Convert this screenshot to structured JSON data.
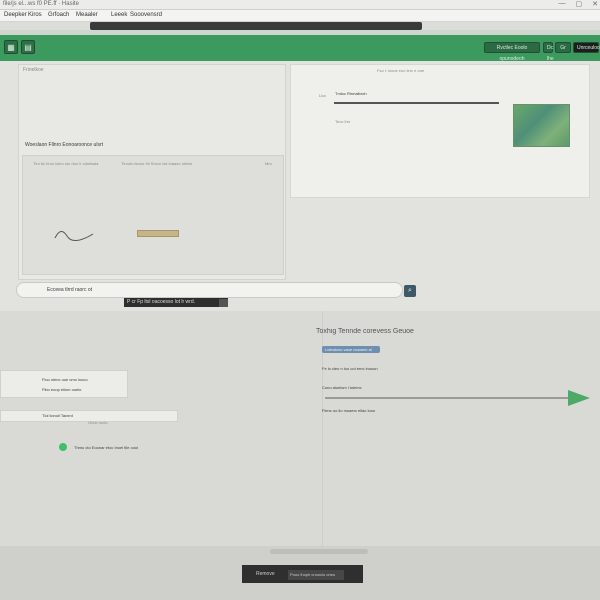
{
  "window": {
    "title": "file/js el...ws f0 PE.ff · Hasite",
    "controls": [
      "—",
      "▢",
      "✕"
    ]
  },
  "menubar": {
    "items": [
      "Deepker",
      "Kiros",
      "Grfoach",
      "Meaaler",
      "Leeek",
      "Sooovensrd"
    ]
  },
  "toolbar": {
    "left_icons": [
      "grid-icon",
      "layers-icon"
    ],
    "right_buttons": [
      "Rvctlec Eoolo opunodeoh",
      "Dc lhe",
      "Gr",
      "Unrceuloolse"
    ]
  },
  "left_pane": {
    "header_line": "Frinelkoe",
    "section_title": "Woeslaon Fllnro Eonoaroonce ulsrt",
    "row_label": "Tlro tlc hroo loleo oto rloo lr cdmlsaia",
    "row_label2": "Tlrootu tlooor lhl Sorcn tsk lnaaoo oleloe",
    "row_tag": "Mm"
  },
  "right_card": {
    "top_line": "Fso l: loooe eoo lerc e ooe",
    "label": "Lloc",
    "field_text": "Tmloc Rhmalbroh",
    "note": "Teoc lhrr"
  },
  "search": {
    "placeholder": "Ecceea tlrrd raorc ot",
    "tooltip": "P cr Fp ltsl oacoesso lot lr wrd."
  },
  "lower": {
    "heading": "Toxhig Tennde corevess Geuoe",
    "pill": "Lolealono vaoe ncaoem al",
    "list_left": [
      "Floo olenc uoe cmo looco",
      "Flbo eoop ellom ooelo",
      "Tlol llonoll Tacnrd",
      "Thmu cto Eoonar etoc Inoel tlle oool"
    ],
    "list_right": [
      "Fe lo cleo n loo ool ernc lnooon",
      "Cono aloelom l tolemc",
      "Flenc oo llo moaerc ellao looo"
    ],
    "sub_label": "Orloc rocto"
  },
  "bottom": {
    "left_text": "Remove",
    "right_text": "Pooo lhoplr cnooclo oneu"
  },
  "colors": {
    "toolbar_green": "#3d9a5f",
    "accent_green": "#4caa66",
    "pill_blue": "#6f8fb0"
  }
}
